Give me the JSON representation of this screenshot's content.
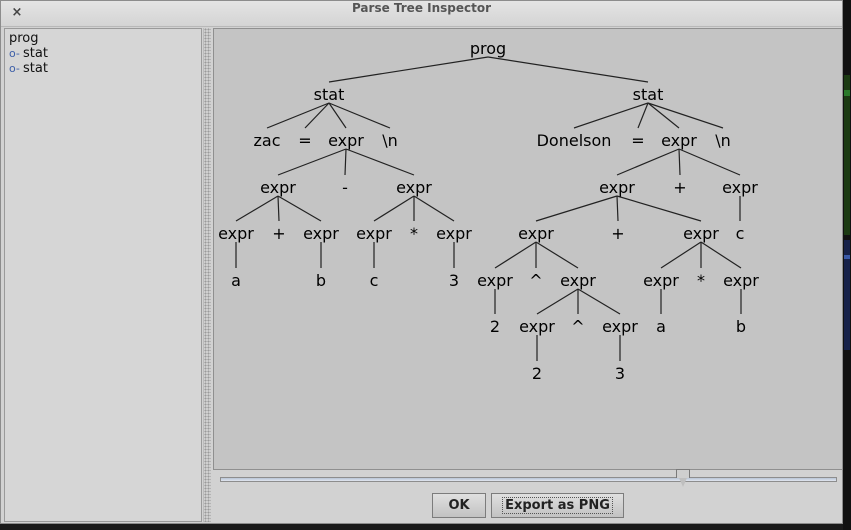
{
  "window": {
    "title": "Parse Tree Inspector",
    "close_icon": "×"
  },
  "outline": {
    "root": "prog",
    "children": [
      {
        "icon": "tree-node-icon",
        "label": "stat"
      },
      {
        "icon": "tree-node-icon",
        "label": "stat"
      }
    ]
  },
  "parse_tree": {
    "label": "prog",
    "children": [
      {
        "label": "stat",
        "children": [
          {
            "label": "zac"
          },
          {
            "label": "="
          },
          {
            "label": "expr",
            "children": [
              {
                "label": "expr",
                "children": [
                  {
                    "label": "expr",
                    "children": [
                      {
                        "label": "a"
                      }
                    ]
                  },
                  {
                    "label": "+"
                  },
                  {
                    "label": "expr",
                    "children": [
                      {
                        "label": "b"
                      }
                    ]
                  }
                ]
              },
              {
                "label": "-"
              },
              {
                "label": "expr",
                "children": [
                  {
                    "label": "expr",
                    "children": [
                      {
                        "label": "c"
                      }
                    ]
                  },
                  {
                    "label": "*"
                  },
                  {
                    "label": "expr",
                    "children": [
                      {
                        "label": "3"
                      }
                    ]
                  }
                ]
              }
            ]
          },
          {
            "label": "\\n"
          }
        ]
      },
      {
        "label": "stat",
        "children": [
          {
            "label": "Donelson"
          },
          {
            "label": "="
          },
          {
            "label": "expr",
            "children": [
              {
                "label": "expr",
                "children": [
                  {
                    "label": "expr",
                    "children": [
                      {
                        "label": "expr",
                        "children": [
                          {
                            "label": "2"
                          }
                        ]
                      },
                      {
                        "label": "^"
                      },
                      {
                        "label": "expr",
                        "children": [
                          {
                            "label": "expr",
                            "children": [
                              {
                                "label": "2"
                              }
                            ]
                          },
                          {
                            "label": "^"
                          },
                          {
                            "label": "expr",
                            "children": [
                              {
                                "label": "3"
                              }
                            ]
                          }
                        ]
                      }
                    ]
                  },
                  {
                    "label": "+"
                  },
                  {
                    "label": "expr",
                    "children": [
                      {
                        "label": "expr",
                        "children": [
                          {
                            "label": "a"
                          }
                        ]
                      },
                      {
                        "label": "*"
                      },
                      {
                        "label": "expr",
                        "children": [
                          {
                            "label": "b"
                          }
                        ]
                      }
                    ]
                  }
                ]
              },
              {
                "label": "+"
              },
              {
                "label": "expr",
                "children": [
                  {
                    "label": "c"
                  }
                ]
              }
            ]
          },
          {
            "label": "\\n"
          }
        ]
      }
    ]
  },
  "zoom_slider": {
    "value_fraction": 0.75
  },
  "buttons": {
    "ok": "OK",
    "export": "Export as PNG"
  }
}
